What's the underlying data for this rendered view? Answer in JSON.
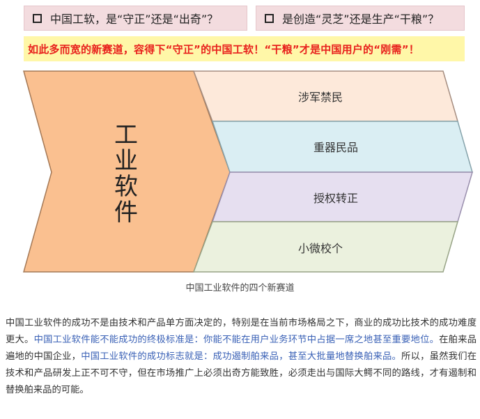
{
  "questions": [
    {
      "text": "中国工软，是“守正”还是“出奇”？"
    },
    {
      "text": "是创造“灵芝”还是生产“干粮”？"
    }
  ],
  "banner": "如此多而宽的新赛道，容得下“守正”的中国工软！“干粮”才是中国用户的“刚需”！",
  "diagram": {
    "main_label": "工业软件",
    "segments": [
      {
        "label": "涉军禁民",
        "color": "#fde9da"
      },
      {
        "label": "重器民品",
        "color": "#daeef3"
      },
      {
        "label": "授权转正",
        "color": "#e6dff0"
      },
      {
        "label": "小微校个",
        "color": "#ebf1de"
      }
    ],
    "main_color": "#fac090",
    "caption": "中国工业软件的四个新赛道"
  },
  "paragraph": {
    "p1": "中国工业软件的成功不是由技术和产品单方面决定的，特别是在当前市场格局之下，商业的成功比技术的成功难度更大。",
    "p2": "中国工业软件能不能成功的终极标准是：你能不能在用户业务环节中占据一席之地甚至重要地位。",
    "p3": "在舶来品遍地的中国企业，",
    "p4": "中国工业软件的成功标志就是：成功遏制舶来品，甚至大批量地替换舶来品。",
    "p5": "所以，虽然我们在技术和产品研发上正不可不守，但在市场推广上必须出奇方能致胜，必须走出与国际大鳄不同的路线，才有遏制和替换舶来品的可能。"
  }
}
